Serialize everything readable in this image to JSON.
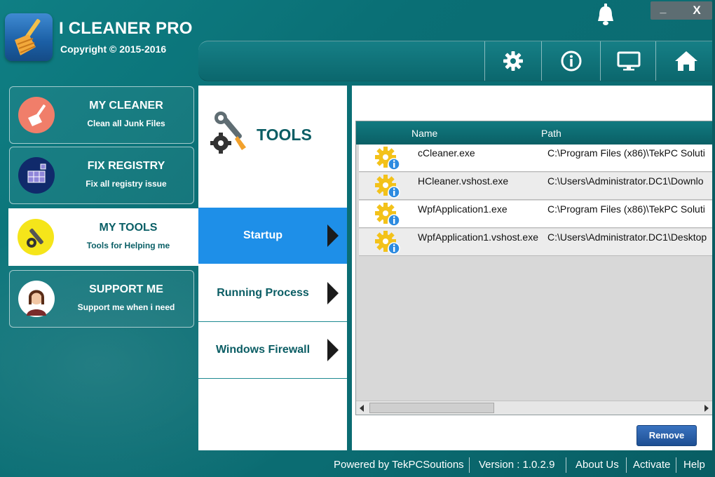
{
  "app": {
    "title": "I CLEANER PRO",
    "copyright": "Copyright © 2015-2016"
  },
  "window_controls": {
    "minimize": "_",
    "close": "X"
  },
  "toolbar": {
    "buttons": [
      {
        "icon": "gear-icon"
      },
      {
        "icon": "info-icon"
      },
      {
        "icon": "monitor-icon"
      },
      {
        "icon": "home-icon"
      }
    ]
  },
  "sidebar": {
    "items": [
      {
        "title": "MY CLEANER",
        "subtitle": "Clean all Junk Files",
        "icon": "broom-icon",
        "active": false
      },
      {
        "title": "FIX REGISTRY",
        "subtitle": "Fix all registry issue",
        "icon": "registry-cubes-icon",
        "active": false
      },
      {
        "title": "MY TOOLS",
        "subtitle": "Tools for Helping me",
        "icon": "tools-icon",
        "active": true
      },
      {
        "title": "SUPPORT ME",
        "subtitle": "Support me when i need",
        "icon": "support-agent-icon",
        "active": false
      }
    ]
  },
  "tools_panel": {
    "heading": "TOOLS",
    "menu": [
      {
        "label": "Startup",
        "active": true
      },
      {
        "label": "Running Process",
        "active": false
      },
      {
        "label": "Windows Firewall",
        "active": false
      }
    ]
  },
  "startup_grid": {
    "columns": [
      "Name",
      "Path"
    ],
    "rows": [
      {
        "name": "cCleaner.exe",
        "path": "C:\\Program Files (x86)\\TekPC Soluti"
      },
      {
        "name": "HCleaner.vshost.exe",
        "path": "C:\\Users\\Administrator.DC1\\Downlo"
      },
      {
        "name": "WpfApplication1.exe",
        "path": "C:\\Program Files (x86)\\TekPC Soluti"
      },
      {
        "name": "WpfApplication1.vshost.exe",
        "path": "C:\\Users\\Administrator.DC1\\Desktop"
      }
    ],
    "remove_label": "Remove"
  },
  "footer": {
    "powered_by": "Powered by TekPCSoutions",
    "version": "Version : 1.0.2.9",
    "about": "About Us",
    "activate": "Activate",
    "help": "Help"
  },
  "colors": {
    "accent_blue": "#1e8fe8",
    "teal_dark": "#0a5f66",
    "background_teal": "#0b6c72"
  }
}
